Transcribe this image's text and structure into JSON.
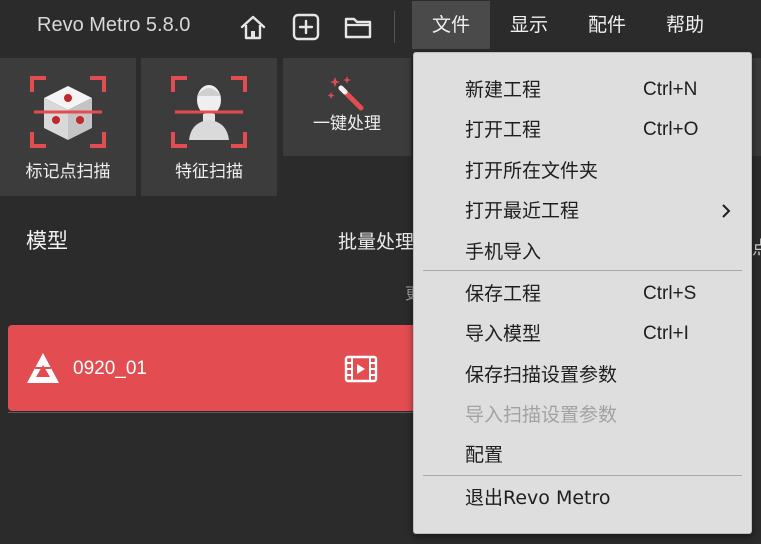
{
  "app": {
    "title": "Revo Metro 5.8.0"
  },
  "titlebar_icons": [
    "home-icon",
    "new-project-icon",
    "open-folder-icon"
  ],
  "menubar": {
    "items": [
      {
        "label": "文件",
        "active": true
      },
      {
        "label": "显示",
        "active": false
      },
      {
        "label": "配件",
        "active": false
      },
      {
        "label": "帮助",
        "active": false
      }
    ]
  },
  "toolbar": {
    "marker_scan": "标记点扫描",
    "feature_scan": "特征扫描",
    "one_click": "一键处理"
  },
  "panel": {
    "title": "模型",
    "batch": "批量处理",
    "cut_text": "更",
    "cut_right": "点",
    "model_name": "0920_01"
  },
  "file_menu": {
    "items": [
      {
        "label": "新建工程",
        "shortcut": "Ctrl+N"
      },
      {
        "label": "打开工程",
        "shortcut": "Ctrl+O"
      },
      {
        "label": "打开所在文件夹",
        "shortcut": ""
      },
      {
        "label": "打开最近工程",
        "shortcut": "",
        "submenu": true
      },
      {
        "label": "手机导入",
        "shortcut": ""
      },
      {
        "label": "保存工程",
        "shortcut": "Ctrl+S"
      },
      {
        "label": "导入模型",
        "shortcut": "Ctrl+I"
      },
      {
        "label": "保存扫描设置参数",
        "shortcut": ""
      },
      {
        "label": "导入扫描设置参数",
        "shortcut": "",
        "disabled": true
      },
      {
        "label": "配置",
        "shortcut": ""
      },
      {
        "label": "退出Revo Metro",
        "shortcut": ""
      }
    ]
  },
  "colors": {
    "accent": "#e34c50",
    "background": "#2b2b2b",
    "menu_bg": "#dedede"
  }
}
